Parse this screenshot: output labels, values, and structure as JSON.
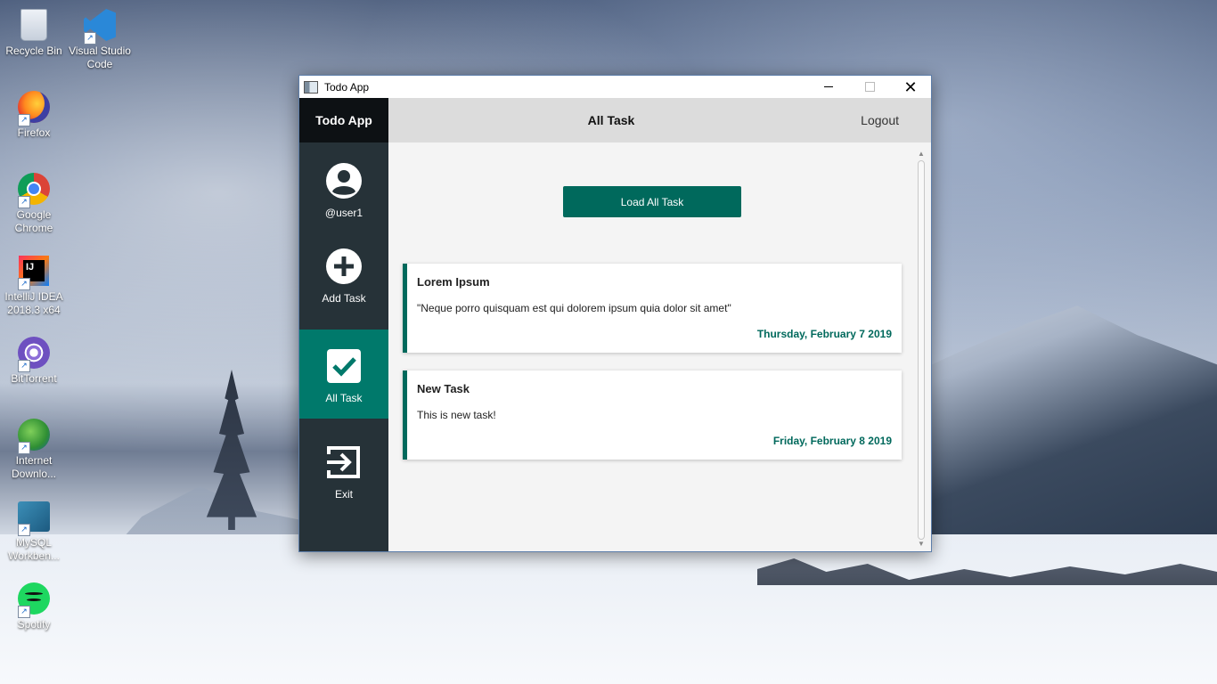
{
  "desktop": {
    "icons": [
      {
        "label": "Recycle Bin",
        "icon": "recycle-bin-icon"
      },
      {
        "label": "Visual Studio Code",
        "icon": "vscode-icon"
      },
      {
        "label": "Firefox",
        "icon": "firefox-icon"
      },
      {
        "label": "Google Chrome",
        "icon": "chrome-icon"
      },
      {
        "label": "IntelliJ IDEA 2018.3 x64",
        "icon": "intellij-icon"
      },
      {
        "label": "BitTorrent",
        "icon": "bittorrent-icon"
      },
      {
        "label": "Internet Downlo...",
        "icon": "internet-download-manager-icon"
      },
      {
        "label": "MySQL Workben...",
        "icon": "mysql-workbench-icon"
      },
      {
        "label": "Spotify",
        "icon": "spotify-icon"
      }
    ]
  },
  "window": {
    "title": "Todo App",
    "controls": {
      "minimize": "minimize-icon",
      "maximize": "maximize-icon",
      "close": "close-icon"
    }
  },
  "app": {
    "brand": "Todo App",
    "header_title": "All Task",
    "logout_label": "Logout",
    "sidebar": [
      {
        "label": "@user1",
        "icon": "user-avatar-icon"
      },
      {
        "label": "Add Task",
        "icon": "add-circle-icon"
      },
      {
        "label": "All Task",
        "icon": "checkbox-icon",
        "active": true
      },
      {
        "label": "Exit",
        "icon": "exit-icon"
      }
    ],
    "load_button": "Load All Task",
    "tasks": [
      {
        "title": "Lorem Ipsum",
        "description": "\"Neque porro quisquam est qui dolorem ipsum quia dolor sit amet\"",
        "date": "Thursday, February 7 2019"
      },
      {
        "title": "New Task",
        "description": "This is new task!",
        "date": "Friday, February 8 2019"
      }
    ]
  },
  "colors": {
    "sidebar": "#263238",
    "brand_bar": "#0d1114",
    "accent": "#00796b",
    "accent_dark": "#00695c",
    "topbar": "#dcdcdc"
  }
}
